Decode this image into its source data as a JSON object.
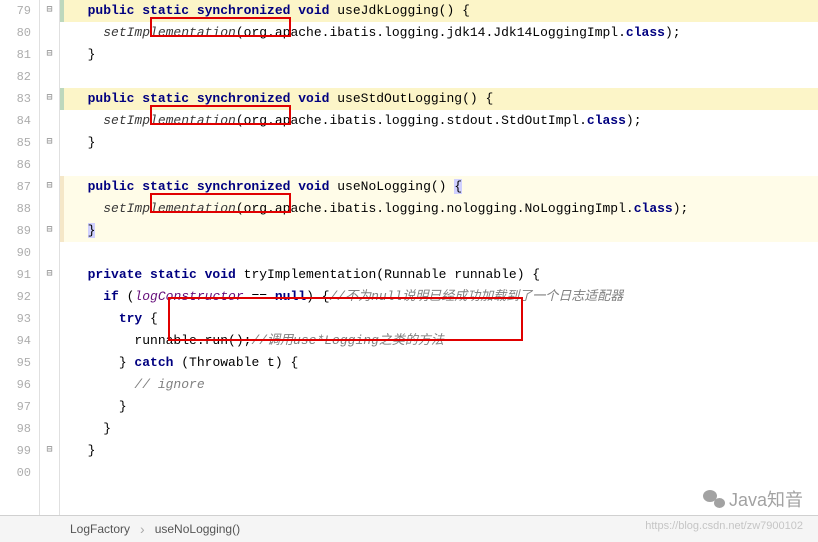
{
  "lines": {
    "start": 79,
    "nums": [
      "79",
      "80",
      "81",
      "82",
      "83",
      "84",
      "85",
      "86",
      "87",
      "88",
      "89",
      "90",
      "91",
      "92",
      "93",
      "94",
      "95",
      "96",
      "97",
      "98",
      "99",
      "00"
    ]
  },
  "code": {
    "l79_kw": "public static synchronized void",
    "l79_m": " useJdkLogging() {",
    "l80_call": "setImplementation",
    "l80_arg": "(org.apache.ibatis.logging.jdk14.Jdk14LoggingImpl.",
    "l80_kw": "class",
    "l80_end": ");",
    "l81": "}",
    "l83_kw": "public static synchronized void",
    "l83_m": " useStdOutLogging() {",
    "l84_call": "setImplementation",
    "l84_arg": "(org.apache.ibatis.logging.stdout.StdOutImpl.",
    "l84_kw": "class",
    "l84_end": ");",
    "l85": "}",
    "l87_kw": "public static synchronized void",
    "l87_m": " useNoLogging() ",
    "l87_brace": "{",
    "l88_call": "setImplementation",
    "l88_arg": "(org.apache.ibatis.logging.nologging.NoLoggingImpl.",
    "l88_kw": "class",
    "l88_end": ");",
    "l89": "}",
    "l91_kw1": "private static void",
    "l91_m": " tryImplementation(Runnable runnable) {",
    "l92_kw": "if",
    "l92_open": " (",
    "l92_ident": "logConstructor",
    "l92_op": " == ",
    "l92_null": "null",
    "l92_close": ") {",
    "l92_comment": "//不为null说明已经成功加载到了一个日志适配器",
    "l93_kw": "try",
    "l93_brace": " {",
    "l94_code": "runnable.run();",
    "l94_comment": "//调用use*Logging之类的方法",
    "l95_brace": "} ",
    "l95_kw": "catch",
    "l95_rest": " (Throwable t) {",
    "l96_comment": "// ignore",
    "l97": "}",
    "l98": "}",
    "l99": "}"
  },
  "breadcrumb": {
    "item1": "LogFactory",
    "item2": "useNoLogging()"
  },
  "watermark": {
    "main": "Java知音",
    "sub": "https://blog.csdn.net/zw7900102"
  }
}
